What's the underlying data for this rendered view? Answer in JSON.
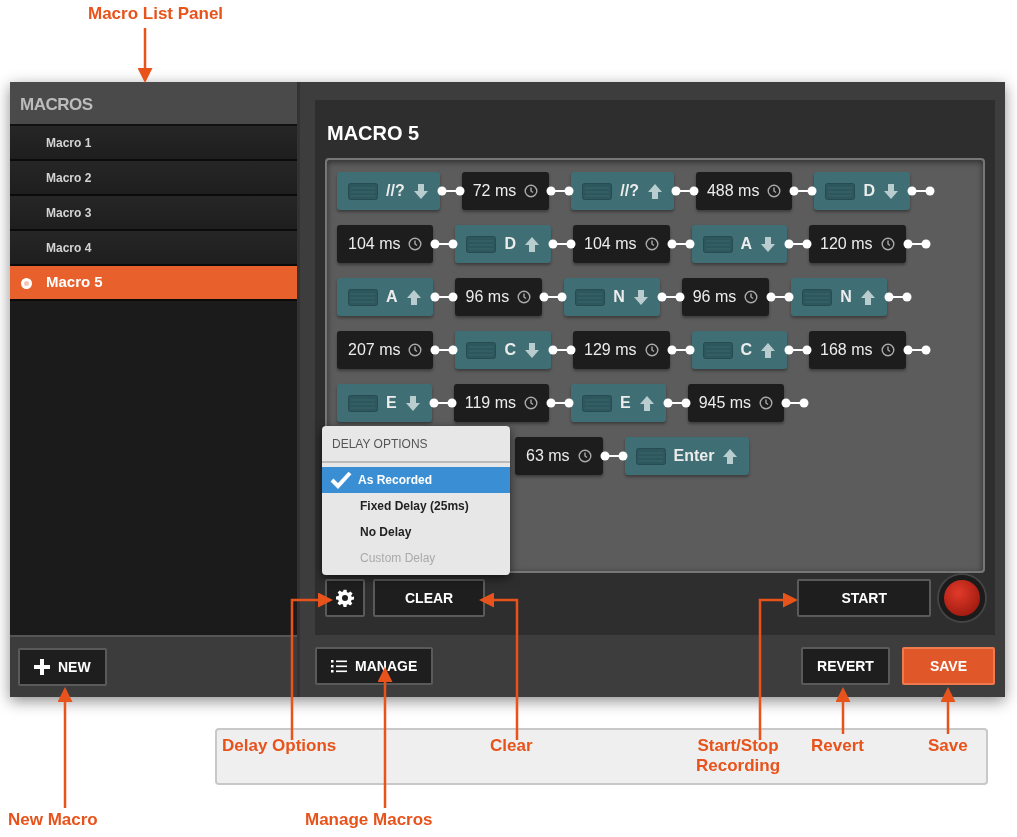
{
  "annotations": [
    {
      "text": "Macro List Panel",
      "kind": "top"
    },
    {
      "text": "Delay Options",
      "kind": "box"
    },
    {
      "text": "Clear",
      "kind": "box"
    },
    {
      "text": "Start/Stop Recording",
      "kind": "box"
    },
    {
      "text": "Revert",
      "kind": "box"
    },
    {
      "text": "Save",
      "kind": "box"
    },
    {
      "text": "New Macro",
      "kind": "bottom"
    },
    {
      "text": "Manage Macros",
      "kind": "bottom"
    }
  ],
  "sidebar": {
    "title": "MACROS",
    "items": [
      {
        "label": "Macro 1",
        "selected": false
      },
      {
        "label": "Macro 2",
        "selected": false
      },
      {
        "label": "Macro 3",
        "selected": false
      },
      {
        "label": "Macro 4",
        "selected": false
      },
      {
        "label": "Macro 5",
        "selected": true
      }
    ],
    "new_button": "NEW"
  },
  "editor": {
    "title": "MACRO 5",
    "rows": [
      {
        "partly_covered": false,
        "steps": [
          {
            "kind": "key",
            "key": "//?",
            "down": true
          },
          {
            "kind": "delay",
            "text": "72 ms"
          },
          {
            "kind": "key",
            "key": "//?",
            "down": false
          },
          {
            "kind": "delay",
            "text": "488 ms"
          },
          {
            "kind": "key",
            "key": "D",
            "down": true
          }
        ]
      },
      {
        "partly_covered": false,
        "steps": [
          {
            "kind": "delay",
            "text": "104 ms"
          },
          {
            "kind": "key",
            "key": "D",
            "down": false
          },
          {
            "kind": "delay",
            "text": "104 ms"
          },
          {
            "kind": "key",
            "key": "A",
            "down": true
          },
          {
            "kind": "delay",
            "text": "120 ms"
          }
        ]
      },
      {
        "partly_covered": false,
        "steps": [
          {
            "kind": "key",
            "key": "A",
            "down": false
          },
          {
            "kind": "delay",
            "text": "96 ms"
          },
          {
            "kind": "key",
            "key": "N",
            "down": true
          },
          {
            "kind": "delay",
            "text": "96 ms"
          },
          {
            "kind": "key",
            "key": "N",
            "down": false
          }
        ]
      },
      {
        "partly_covered": false,
        "steps": [
          {
            "kind": "delay",
            "text": "207 ms"
          },
          {
            "kind": "key",
            "key": "C",
            "down": true
          },
          {
            "kind": "delay",
            "text": "129 ms"
          },
          {
            "kind": "key",
            "key": "C",
            "down": false
          },
          {
            "kind": "delay",
            "text": "168 ms"
          }
        ]
      },
      {
        "partly_covered": false,
        "steps": [
          {
            "kind": "key",
            "key": "E",
            "down": true
          },
          {
            "kind": "delay",
            "text": "119 ms"
          },
          {
            "kind": "key",
            "key": "E",
            "down": false
          },
          {
            "kind": "delay",
            "text": "945 ms"
          }
        ]
      },
      {
        "partly_covered": true,
        "steps": [
          {
            "kind": "delay",
            "text": "63 ms"
          },
          {
            "kind": "key",
            "key": "Enter",
            "down": false
          }
        ]
      }
    ],
    "delay_menu": {
      "title": "DELAY OPTIONS",
      "items": [
        {
          "label": "As Recorded",
          "selected": true,
          "disabled": false
        },
        {
          "label": "Fixed Delay (25ms)",
          "selected": false,
          "disabled": false
        },
        {
          "label": "No Delay",
          "selected": false,
          "disabled": false
        },
        {
          "label": "Custom Delay",
          "selected": false,
          "disabled": true
        }
      ]
    },
    "clear_button": "CLEAR",
    "start_button": "START"
  },
  "bottom_bar": {
    "manage_button": "MANAGE",
    "revert_button": "REVERT",
    "save_button": "SAVE"
  }
}
